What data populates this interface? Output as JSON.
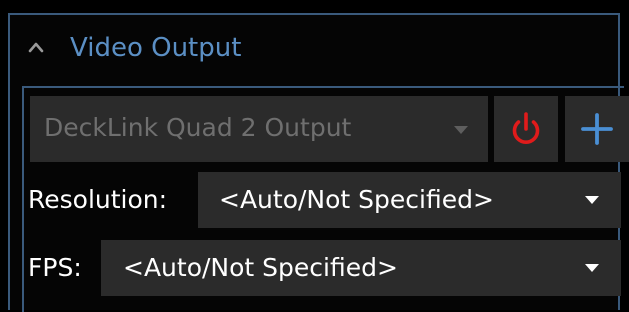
{
  "panel": {
    "title": "Video Output",
    "collapse_icon": "chevron-up-icon",
    "border_color": "#3a5a7c",
    "title_color": "#5b8fc4"
  },
  "output": {
    "device_selected": "DeckLink Quad 2 Output",
    "device_state": "disabled",
    "power_icon": "power-icon",
    "power_color": "#e01b1b",
    "add_icon": "plus-icon",
    "add_color": "#4a8fd4"
  },
  "resolution": {
    "label": "Resolution:",
    "value": "<Auto/Not Specified>"
  },
  "fps": {
    "label": "FPS:",
    "value": "<Auto/Not Specified>"
  }
}
